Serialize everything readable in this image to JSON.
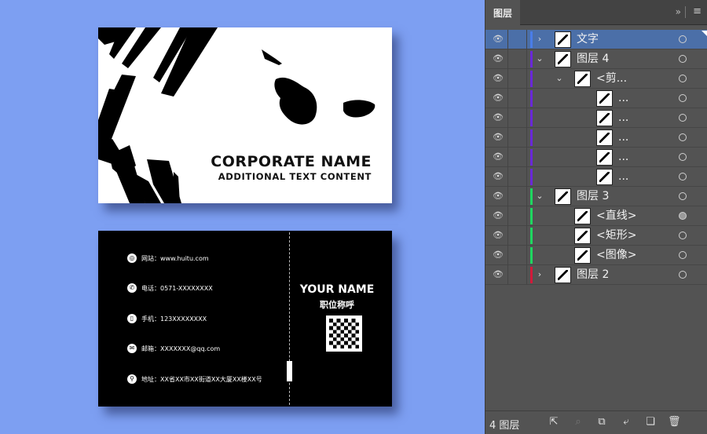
{
  "front_card": {
    "corporate_name": "CORPORATE NAME",
    "additional_text": "ADDITIONAL TEXT CONTENT"
  },
  "back_card": {
    "contacts": [
      {
        "icon": "globe-icon",
        "glyph": "◎",
        "label": "网站：",
        "value": "www.huitu.com"
      },
      {
        "icon": "phone-icon",
        "glyph": "✆",
        "label": "电话：",
        "value": "0571-XXXXXXXX"
      },
      {
        "icon": "mobile-icon",
        "glyph": "▯",
        "label": "手机：",
        "value": "123XXXXXXXX"
      },
      {
        "icon": "mail-icon",
        "glyph": "✉",
        "label": "邮箱：",
        "value": "XXXXXXX@qq.com"
      },
      {
        "icon": "location-icon",
        "glyph": "⚲",
        "label": "地址：",
        "value": "XX省XX市XX街道XX大厦XX楼XX号"
      }
    ],
    "your_name": "YOUR NAME",
    "position_title": "职位称呼"
  },
  "layers_panel": {
    "tab_label": "图层",
    "collapse_glyph": "»",
    "menu_glyph": "≡",
    "footer_count": "4 图层",
    "footer_icons": [
      {
        "name": "export-icon",
        "glyph": "⇱",
        "dim": false
      },
      {
        "name": "search-icon",
        "glyph": "⌕",
        "dim": true
      },
      {
        "name": "clipping-mask-icon",
        "glyph": "⧉",
        "dim": false
      },
      {
        "name": "new-sublayer-icon",
        "glyph": "⤶",
        "dim": false
      },
      {
        "name": "new-layer-icon",
        "glyph": "❏",
        "dim": false
      },
      {
        "name": "delete-layer-icon",
        "glyph": "🗑",
        "dim": false
      }
    ],
    "layers": [
      {
        "name": "文字",
        "indent": 0,
        "chevron": "›",
        "color": "#4a7de8",
        "selected": true,
        "target_filled": false
      },
      {
        "name": "图层 4",
        "indent": 0,
        "chevron": "⌄",
        "color": "#6a28d8",
        "selected": false,
        "target_filled": false
      },
      {
        "name": "<剪...",
        "indent": 1,
        "chevron": "⌄",
        "color": "#6a28d8",
        "selected": false,
        "target_filled": false
      },
      {
        "name": "...",
        "indent": 2,
        "chevron": "",
        "color": "#6a28d8",
        "selected": false,
        "target_filled": false
      },
      {
        "name": "...",
        "indent": 2,
        "chevron": "",
        "color": "#6a28d8",
        "selected": false,
        "target_filled": false
      },
      {
        "name": "...",
        "indent": 2,
        "chevron": "",
        "color": "#6a28d8",
        "selected": false,
        "target_filled": false
      },
      {
        "name": "...",
        "indent": 2,
        "chevron": "",
        "color": "#6a28d8",
        "selected": false,
        "target_filled": false
      },
      {
        "name": "...",
        "indent": 2,
        "chevron": "",
        "color": "#6a28d8",
        "selected": false,
        "target_filled": false
      },
      {
        "name": "图层 3",
        "indent": 0,
        "chevron": "⌄",
        "color": "#1ed760",
        "selected": false,
        "target_filled": false
      },
      {
        "name": "<直线>",
        "indent": 1,
        "chevron": "",
        "color": "#1ed760",
        "selected": false,
        "target_filled": true
      },
      {
        "name": "<矩形>",
        "indent": 1,
        "chevron": "",
        "color": "#1ed760",
        "selected": false,
        "target_filled": false
      },
      {
        "name": "<图像>",
        "indent": 1,
        "chevron": "",
        "color": "#1ed760",
        "selected": false,
        "target_filled": false
      },
      {
        "name": "图层 2",
        "indent": 0,
        "chevron": "›",
        "color": "#d21a3a",
        "selected": false,
        "target_filled": false
      }
    ]
  }
}
